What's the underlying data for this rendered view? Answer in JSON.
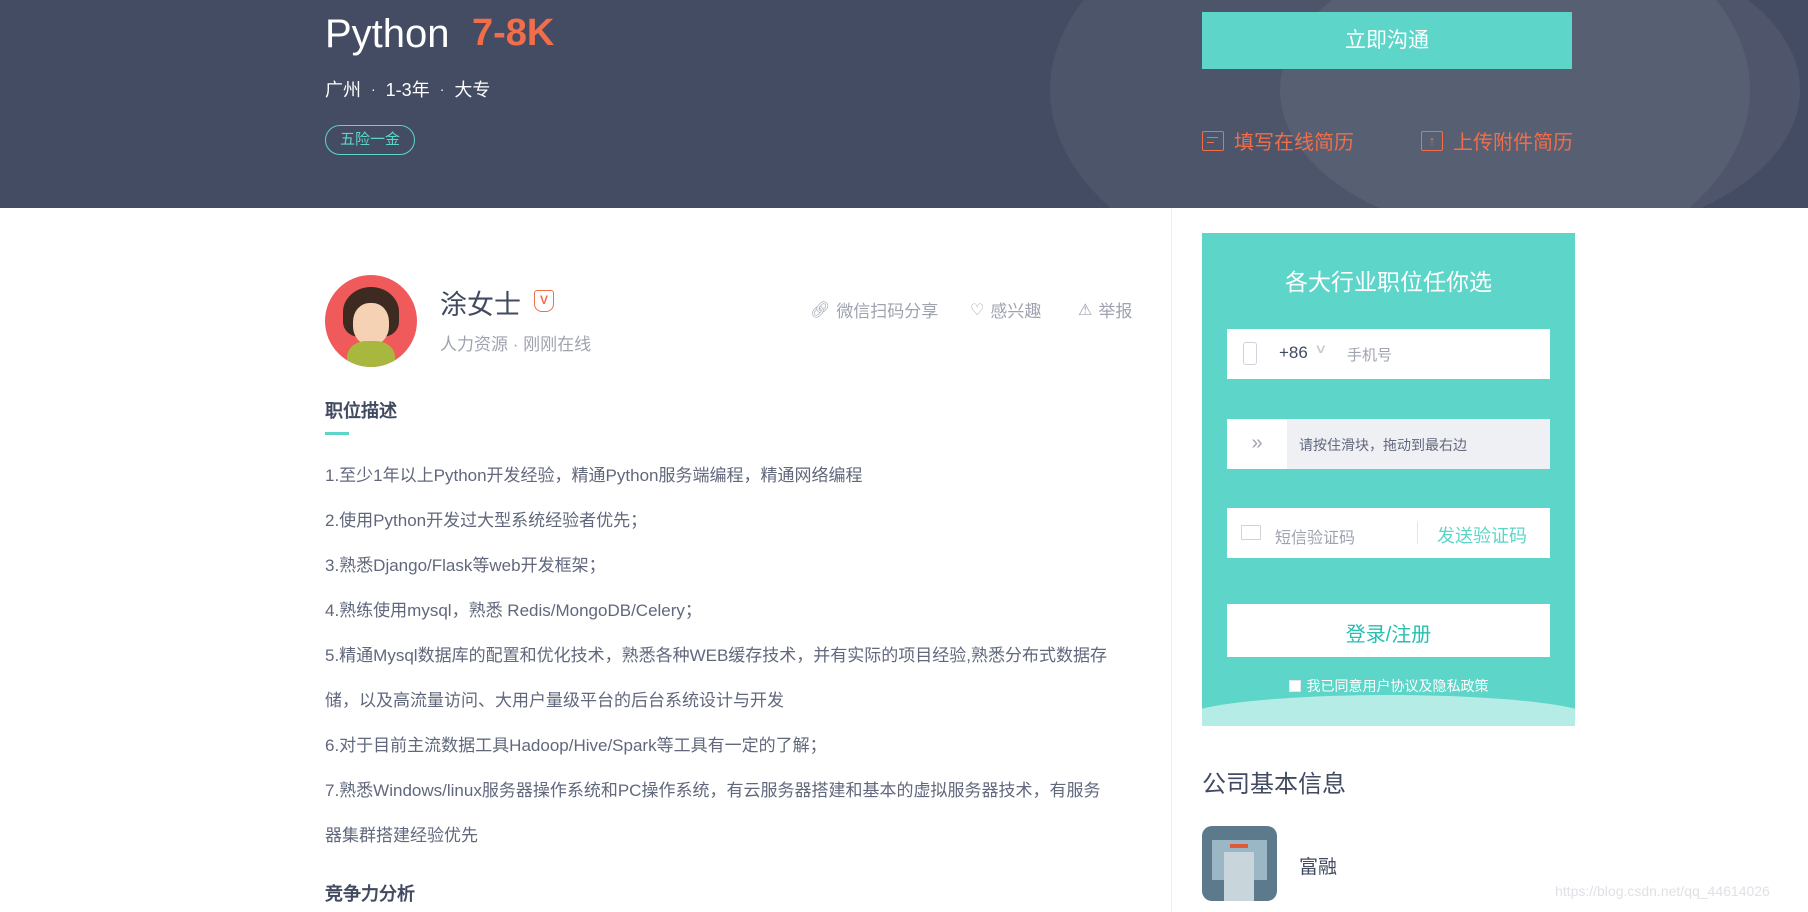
{
  "job": {
    "title": "Python",
    "salary": "7-8K",
    "city": "广州",
    "experience": "1-3年",
    "education": "大专",
    "meta_sep": "·",
    "benefit_tag": "五险一金"
  },
  "actions": {
    "chat_button": "立即沟通",
    "online_resume": "填写在线简历",
    "upload_resume": "上传附件简历"
  },
  "recruiter": {
    "name": "涂女士",
    "verify_badge": "V",
    "role": "人力资源",
    "status": "刚刚在线",
    "sep": "·"
  },
  "toolbar": {
    "share": "微信扫码分享",
    "interest": "感兴趣",
    "report": "举报"
  },
  "description": {
    "title": "职位描述",
    "lines": [
      "1.至少1年以上Python开发经验，精通Python服务端编程，精通网络编程",
      "2.使用Python开发过大型系统经验者优先；",
      "3.熟悉Django/Flask等web开发框架；",
      "4.熟练使用mysql，熟悉 Redis/MongoDB/Celery；",
      "5.精通Mysql数据库的配置和优化技术，熟悉各种WEB缓存技术，并有实际的项目经验,熟悉分布式数据存",
      "储，以及高流量访问、大用户量级平台的后台系统设计与开发",
      "6.对于目前主流数据工具Hadoop/Hive/Spark等工具有一定的了解；",
      "7.熟悉Windows/linux服务器操作系统和PC操作系统，有云服务器搭建和基本的虚拟服务器技术，有服务",
      "器集群搭建经验优先"
    ]
  },
  "competition": {
    "title": "竞争力分析"
  },
  "login_card": {
    "title": "各大行业职位任你选",
    "country_code": "+86",
    "phone_placeholder": "手机号",
    "slider_hint": "请按住滑块，拖动到最右边",
    "sms_placeholder": "短信验证码",
    "send_code": "发送验证码",
    "submit": "登录/注册",
    "agreement": "我已同意用户协议及隐私政策"
  },
  "company": {
    "heading": "公司基本信息",
    "name": "富融"
  },
  "watermark": "https://blog.csdn.net/qq_44614026",
  "colors": {
    "banner_bg": "#444c63",
    "accent": "#5dd5c8",
    "salary": "#f26d49"
  },
  "icons": [
    "phone-icon",
    "mail-icon",
    "link-icon",
    "heart-icon",
    "warning-icon",
    "document-icon",
    "upload-icon",
    "chevron-down-icon",
    "double-chevron-right-icon",
    "verified-badge-icon"
  ]
}
